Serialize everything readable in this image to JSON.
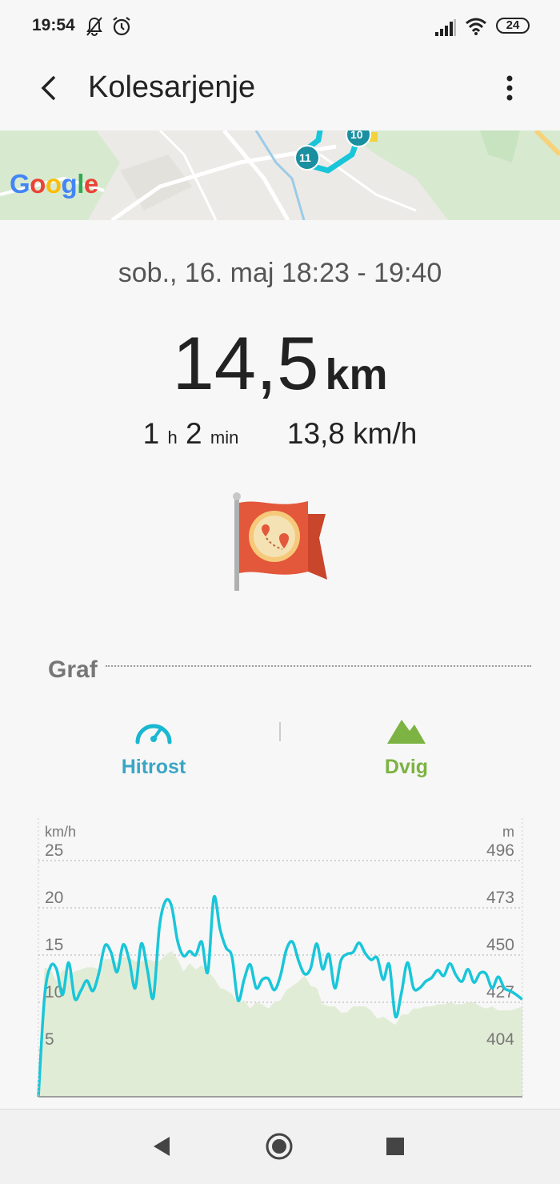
{
  "status_bar": {
    "time": "19:54",
    "battery": "24"
  },
  "header": {
    "title": "Kolesarjenje"
  },
  "map": {
    "logo": "Google",
    "markers": [
      "11",
      "10"
    ]
  },
  "summary": {
    "datetime": "sob., 16. maj 18:23 - 19:40",
    "distance_value": "14,5",
    "distance_unit": "km",
    "hours": "1",
    "hours_unit": "h",
    "minutes": "2",
    "minutes_unit": "min",
    "avg_speed": "13,8 km/h"
  },
  "graph_section": {
    "title": "Graf",
    "tabs": [
      {
        "label": "Hitrost",
        "icon": "speedometer-icon",
        "color": "#3aa6c4"
      },
      {
        "label": "Dvig",
        "icon": "mountain-icon",
        "color": "#7cb342"
      }
    ]
  },
  "colors": {
    "speed": "#19c6d9",
    "elevation_fill": "#e1ecd6",
    "speed_tab": "#3aa6c4",
    "elevation_tab": "#7cb342"
  },
  "chart_data": {
    "type": "line",
    "left_axis": {
      "unit": "km/h",
      "ticks": [
        "25",
        "20",
        "15",
        "10",
        "5"
      ],
      "ylim": [
        0,
        25
      ]
    },
    "right_axis": {
      "unit": "m",
      "ticks": [
        "496",
        "473",
        "450",
        "427",
        "404"
      ],
      "ylim": [
        381,
        496
      ]
    },
    "grid": true,
    "series": [
      {
        "key": "speed",
        "values": [
          0,
          10.5,
          13.8,
          13.5,
          10.8,
          14.2,
          10.4,
          11.2,
          12.3,
          11.2,
          13.1,
          16,
          15.3,
          13.2,
          16.1,
          14.5,
          11.5,
          16.2,
          13.5,
          10.5,
          18,
          20.7,
          20.2,
          16.5,
          14.9,
          15.4,
          15,
          16.4,
          13.2,
          21.1,
          17.8,
          15.8,
          14.8,
          10.2,
          12.4,
          14,
          11.5,
          12.4,
          12.5,
          11.3,
          12.8,
          15.6,
          16.4,
          14.4,
          13,
          13.6,
          16.2,
          13.5,
          15.1,
          11.5,
          14.4,
          15.1,
          15.3,
          16.3,
          15.2,
          14.5,
          14.7,
          12.4,
          14,
          8.5,
          11,
          14.2,
          11.5,
          11.5,
          12.2,
          12.6,
          13.4,
          12.8,
          14.1,
          12.9,
          12.2,
          13.5,
          12.1,
          13.1,
          13,
          11.5,
          12.7,
          11.5,
          11.2,
          10.8,
          10.3
        ]
      },
      {
        "key": "elevation",
        "values": [
          381,
          444,
          443,
          437,
          443,
          441,
          442,
          443,
          444,
          444,
          443,
          448,
          448,
          446,
          449,
          449,
          447,
          447,
          448,
          447,
          447,
          450,
          452,
          448,
          442,
          446,
          443,
          445,
          442,
          439,
          434,
          433,
          431,
          427,
          428,
          424,
          427,
          426,
          424,
          427,
          428,
          433,
          435,
          437,
          440,
          435,
          434,
          426,
          425,
          425,
          422,
          422,
          425,
          425,
          425,
          423,
          419,
          420,
          418,
          416,
          421,
          421,
          424,
          424,
          425,
          425,
          426,
          426,
          427,
          426,
          426,
          427,
          427,
          425,
          424,
          425,
          423,
          423,
          423,
          424,
          425
        ]
      }
    ]
  }
}
